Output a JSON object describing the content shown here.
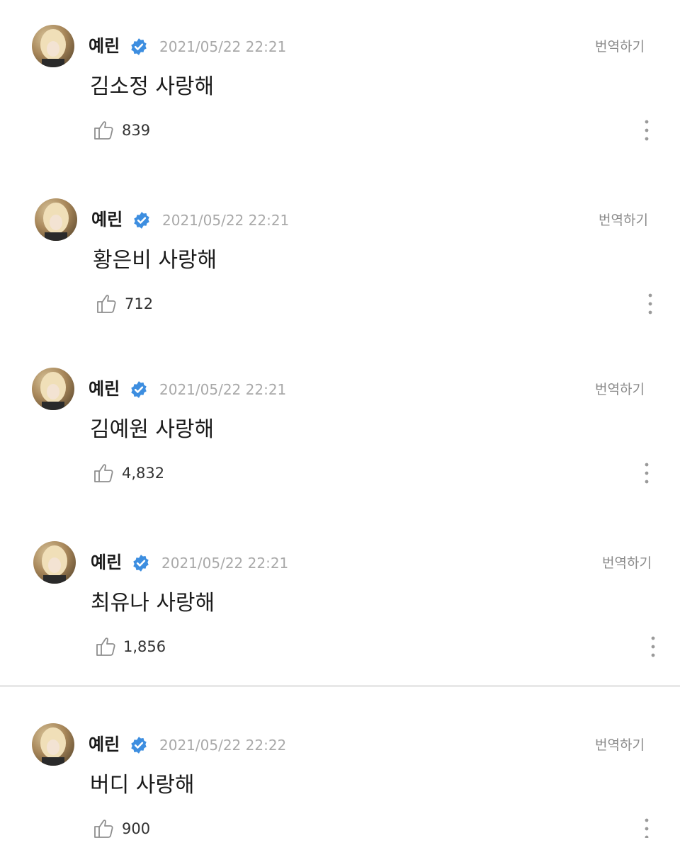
{
  "comments": [
    {
      "author": "예린",
      "date": "2021/05/22 22:21",
      "translate": "번역하기",
      "text": "김소정 사랑해",
      "likes": "839"
    },
    {
      "author": "예린",
      "date": "2021/05/22 22:21",
      "translate": "번역하기",
      "text": "황은비 사랑해",
      "likes": "712"
    },
    {
      "author": "예린",
      "date": "2021/05/22 22:21",
      "translate": "번역하기",
      "text": "김예원 사랑해",
      "likes": "4,832"
    },
    {
      "author": "예린",
      "date": "2021/05/22 22:21",
      "translate": "번역하기",
      "text": "최유나 사랑해",
      "likes": "1,856"
    },
    {
      "author": "예린",
      "date": "2021/05/22 22:22",
      "translate": "번역하기",
      "text": "버디 사랑해",
      "likes": "900"
    }
  ],
  "icons": {
    "verified": "verified-badge-icon",
    "like": "thumbs-up-icon",
    "more": "more-vertical-icon"
  },
  "colors": {
    "verified": "#3d8ee0",
    "date": "#a9a9a9",
    "translate": "#8a8a8a"
  }
}
